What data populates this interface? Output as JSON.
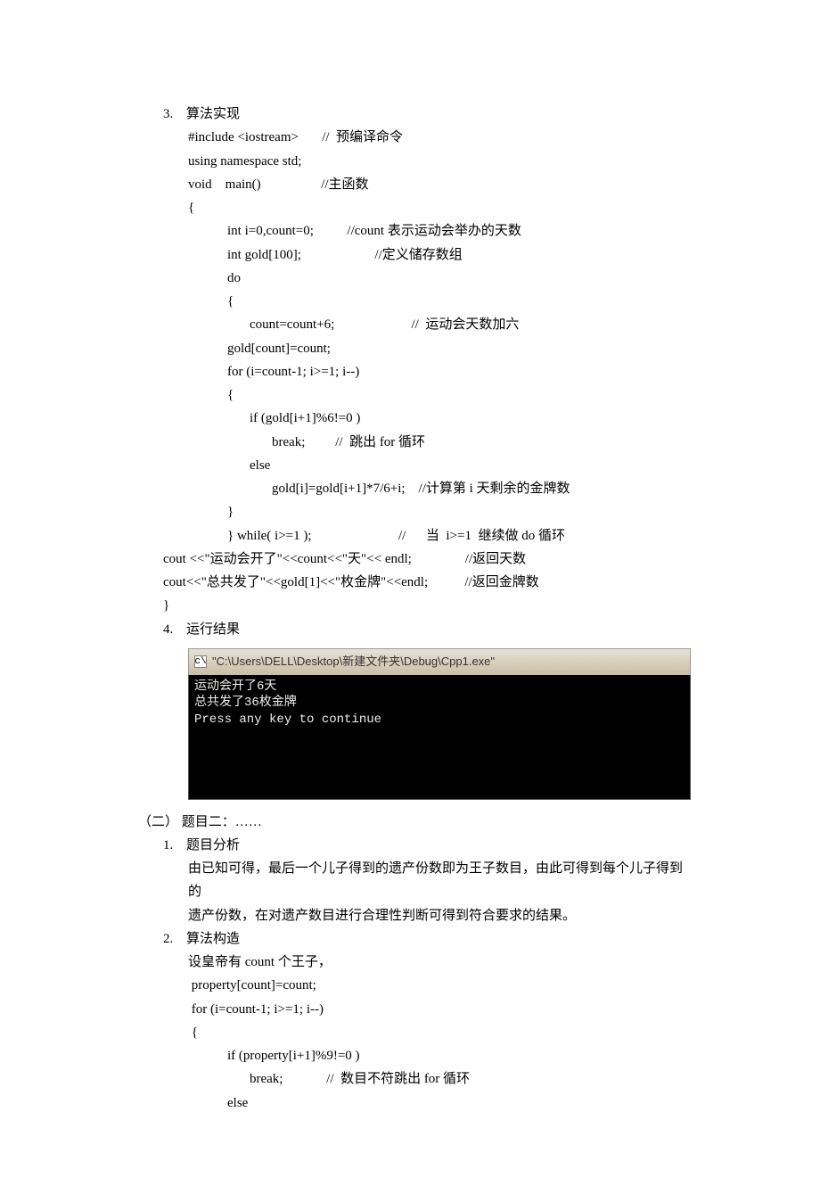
{
  "sections": {
    "s3_num": "3.",
    "s3_title": "算法实现",
    "s3_code": {
      "l01": "#include <iostream>       //  预编译命令",
      "l02": "using namespace std;",
      "l03": "void    main()                  //主函数",
      "l04": "{",
      "l05": "int i=0,count=0;          //count 表示运动会举办的天数",
      "l06": "int gold[100];                      //定义储存数组",
      "l07": "do",
      "l08": "{",
      "l09": "count=count+6;                       //  运动会天数加六",
      "l10": "gold[count]=count;",
      "l11": "for (i=count-1; i>=1; i--)",
      "l12": "{",
      "l13": "if (gold[i+1]%6!=0 )",
      "l14": "break;         //  跳出 for 循环",
      "l15": "else",
      "l16": "gold[i]=gold[i+1]*7/6+i;    //计算第 i 天剩余的金牌数",
      "l17": "}",
      "l18": "} while( i>=1 );                          //      当  i>=1  继续做 do 循环",
      "l19": "cout <<\"运动会开了\"<<count<<\"天\"<< endl;                //返回天数",
      "l20": "cout<<\"总共发了\"<<gold[1]<<\"枚金牌\"<<endl;           //返回金牌数",
      "l21": "}"
    },
    "s4_num": "4.",
    "s4_title": "运行结果",
    "console": {
      "title": "\"C:\\Users\\DELL\\Desktop\\新建文件夹\\Debug\\Cpp1.exe\"",
      "line1": "运动会开了6天",
      "line2": "总共发了36枚金牌",
      "line3": "Press any key to continue"
    },
    "two_label": "（二）  题目二：……",
    "s1_num": "1.",
    "s1_title": "题目分析",
    "s1_text1": "由已知可得，最后一个儿子得到的遗产份数即为王子数目，由此可得到每个儿子得到的",
    "s1_text2": "遗产份数，在对遗产数目进行合理性判断可得到符合要求的结果。",
    "s2_num": "2.",
    "s2_title": "算法构造",
    "s2_code": {
      "l01": "设皇帝有 count 个王子，",
      "l02": " property[count]=count;",
      "l03": " for (i=count-1; i>=1; i--)",
      "l04": " {",
      "l05": "if (property[i+1]%9!=0 )",
      "l06": "break;             //  数目不符跳出 for 循环",
      "l07": "else"
    }
  }
}
